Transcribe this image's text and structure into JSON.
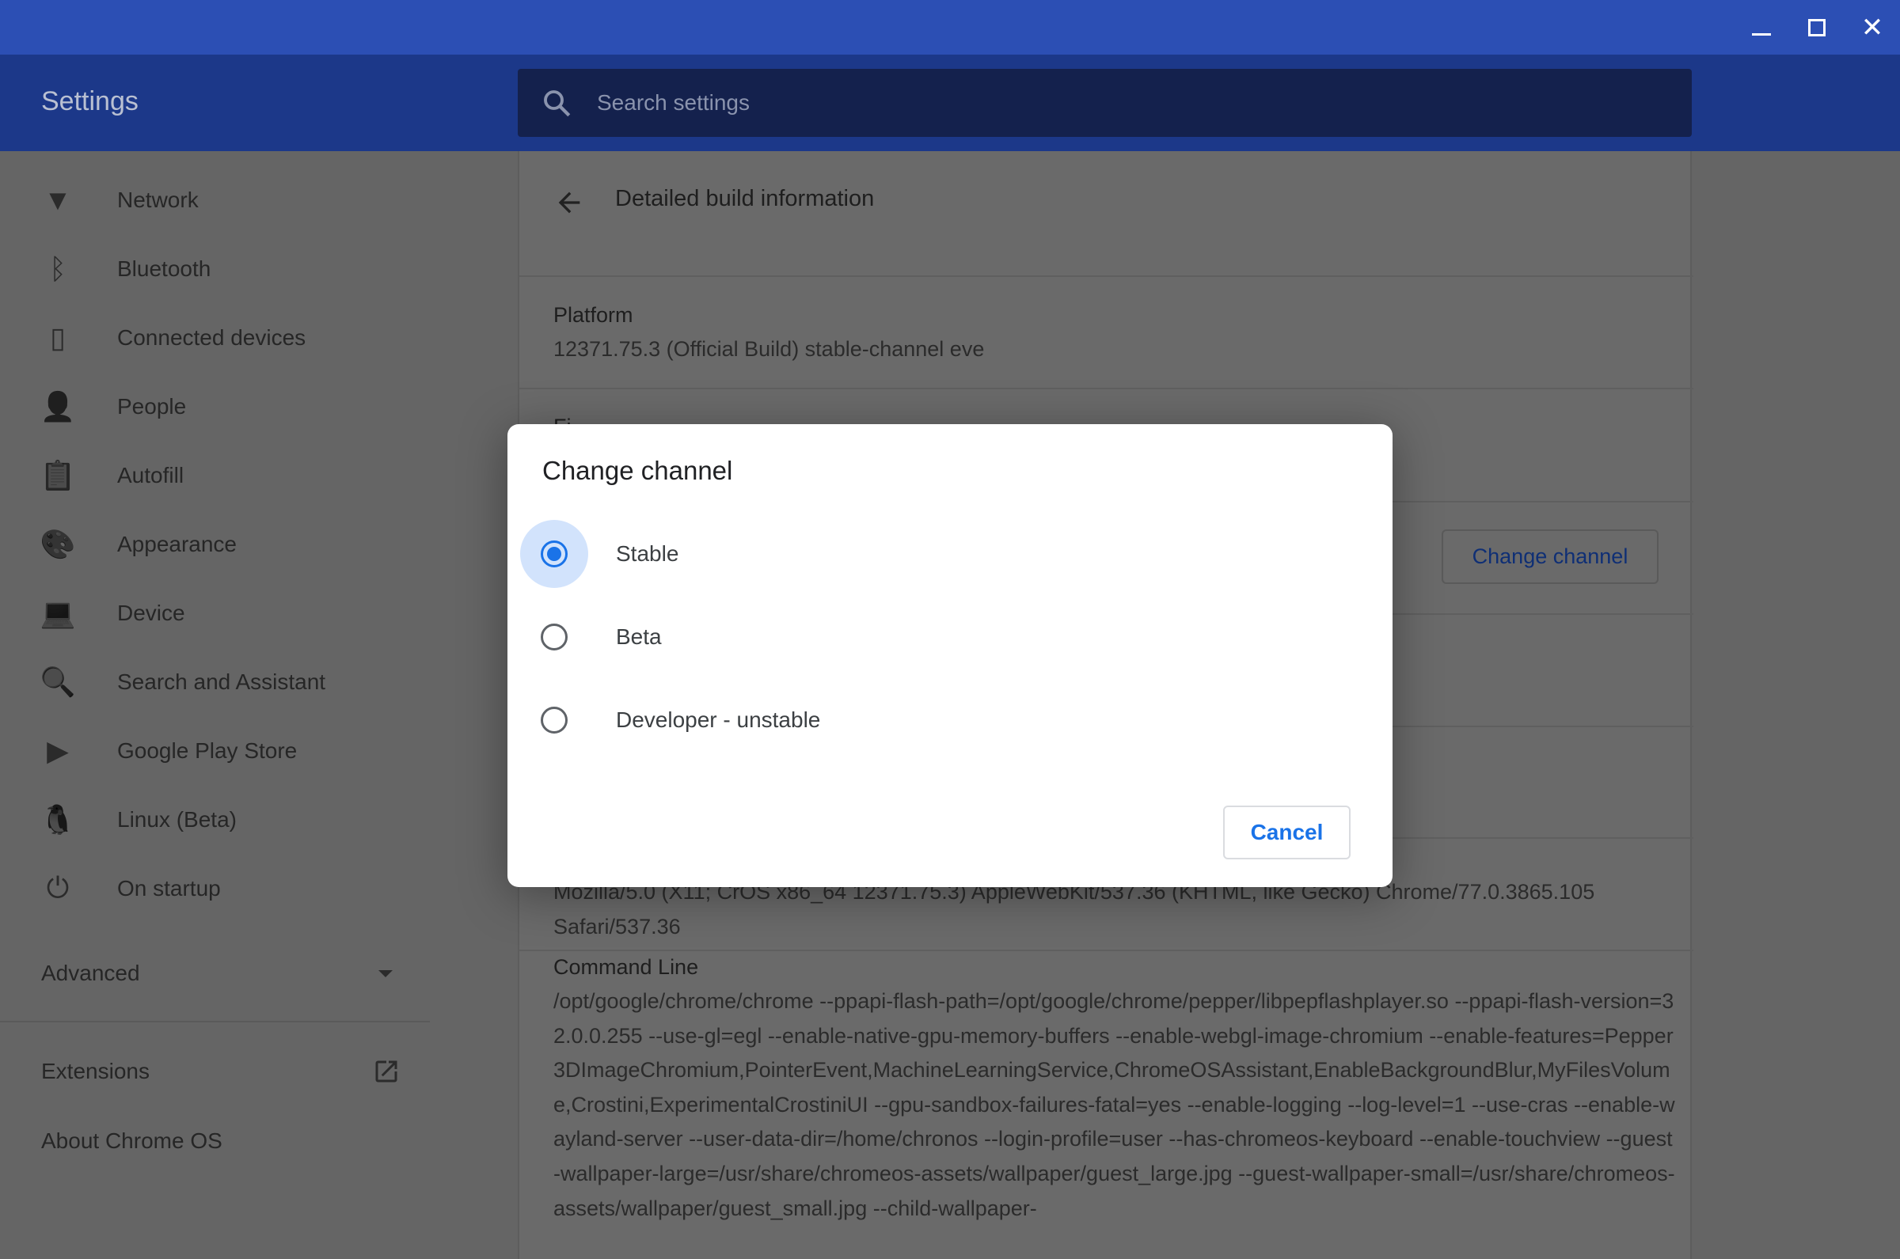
{
  "window": {
    "minimize": "—",
    "maximize": "☐",
    "close": "✕"
  },
  "header": {
    "title": "Settings",
    "search_placeholder": "Search settings"
  },
  "sidebar": {
    "items": [
      {
        "label": "Network",
        "icon": "wifi-icon",
        "glyph": "▼"
      },
      {
        "label": "Bluetooth",
        "icon": "bluetooth-icon",
        "glyph": "ᛒ"
      },
      {
        "label": "Connected devices",
        "icon": "phone-icon",
        "glyph": "▯"
      },
      {
        "label": "People",
        "icon": "person-icon",
        "glyph": "👤"
      },
      {
        "label": "Autofill",
        "icon": "clipboard-icon",
        "glyph": "📋"
      },
      {
        "label": "Appearance",
        "icon": "palette-icon",
        "glyph": "🎨"
      },
      {
        "label": "Device",
        "icon": "laptop-icon",
        "glyph": "💻"
      },
      {
        "label": "Search and Assistant",
        "icon": "search-icon",
        "glyph": "🔍"
      },
      {
        "label": "Google Play Store",
        "icon": "play-store-icon",
        "glyph": "▶"
      },
      {
        "label": "Linux (Beta)",
        "icon": "penguin-icon",
        "glyph": "🐧"
      },
      {
        "label": "On startup",
        "icon": "power-icon",
        "glyph": "⏻"
      }
    ],
    "advanced": "Advanced",
    "extensions": "Extensions",
    "about": "About Chrome OS"
  },
  "content": {
    "title": "Detailed build information",
    "platform_label": "Platform",
    "platform_value": "12371.75.3 (Official Build) stable-channel eve",
    "firmware_label_partial": "Fi",
    "change_channel": "Change channel",
    "user_agent_line1": "Mozilla/5.0 (X11; CrOS x86_64 12371.75.3) AppleWebKit/537.36 (KHTML, like Gecko) Chrome/77.0.3865.105",
    "user_agent_line2": "Safari/537.36",
    "command_line_label": "Command Line",
    "command_line_value": "/opt/google/chrome/chrome --ppapi-flash-path=/opt/google/chrome/pepper/libpepflashplayer.so --ppapi-flash-version=32.0.0.255 --use-gl=egl --enable-native-gpu-memory-buffers --enable-webgl-image-chromium --enable-features=Pepper3DImageChromium,PointerEvent,MachineLearningService,ChromeOSAssistant,EnableBackgroundBlur,MyFilesVolume,Crostini,ExperimentalCrostiniUI --gpu-sandbox-failures-fatal=yes --enable-logging --log-level=1 --use-cras --enable-wayland-server --user-data-dir=/home/chronos --login-profile=user --has-chromeos-keyboard --enable-touchview --guest-wallpaper-large=/usr/share/chromeos-assets/wallpaper/guest_large.jpg --guest-wallpaper-small=/usr/share/chromeos-assets/wallpaper/guest_small.jpg --child-wallpaper-"
  },
  "dialog": {
    "title": "Change channel",
    "options": [
      {
        "label": "Stable",
        "selected": true
      },
      {
        "label": "Beta",
        "selected": false
      },
      {
        "label": "Developer - unstable",
        "selected": false
      }
    ],
    "cancel": "Cancel",
    "accent": "#1a73e8"
  }
}
